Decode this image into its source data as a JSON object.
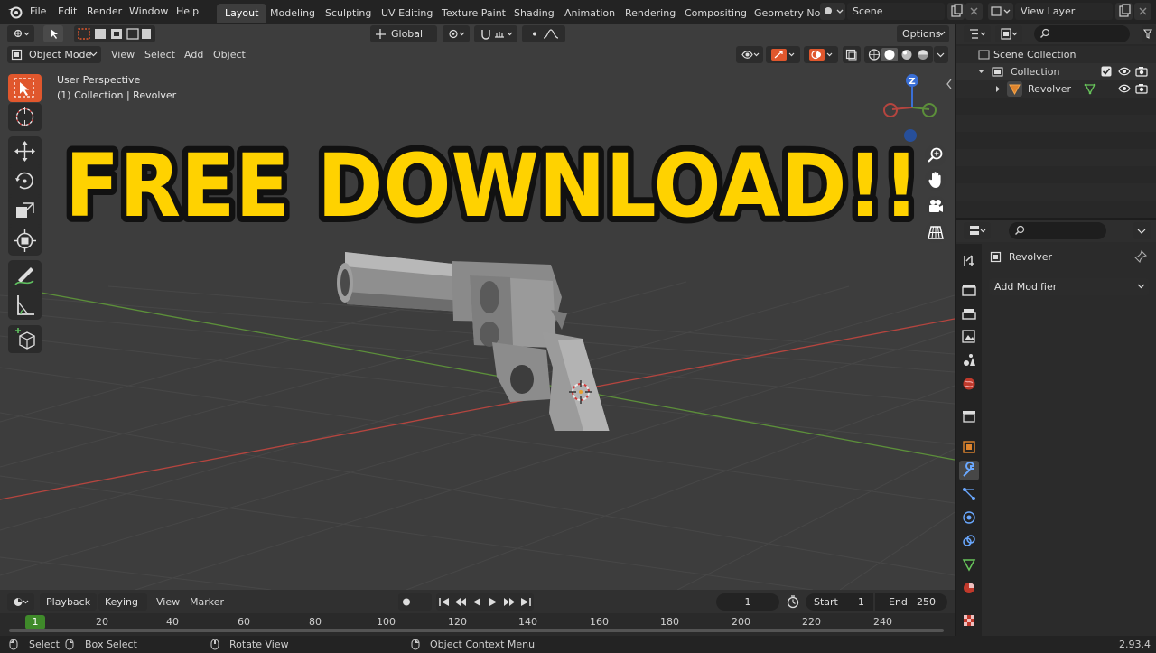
{
  "menu": {
    "items": [
      "File",
      "Edit",
      "Render",
      "Window",
      "Help"
    ]
  },
  "workspaces": {
    "tabs": [
      "Layout",
      "Modeling",
      "Sculpting",
      "UV Editing",
      "Texture Paint",
      "Shading",
      "Animation",
      "Rendering",
      "Compositing",
      "Geometry No"
    ],
    "active": "Layout"
  },
  "scene": {
    "name": "Scene"
  },
  "view_layer": {
    "name": "View Layer"
  },
  "header": {
    "transform_orientation": "Global",
    "options_label": "Options",
    "mode": "Object Mode",
    "menus": [
      "View",
      "Select",
      "Add",
      "Object"
    ]
  },
  "viewport": {
    "perspective_label": "User Perspective",
    "collection_label": "(1) Collection | Revolver",
    "banner_text": "FREE DOWNLOAD!!",
    "gizmo_axis_label": "Z"
  },
  "timeline": {
    "menus": [
      "Playback",
      "Keying",
      "View",
      "Marker"
    ],
    "current_frame": "1",
    "start_label": "Start",
    "start_value": "1",
    "end_label": "End",
    "end_value": "250",
    "ruler_current": "1",
    "ruler_ticks": [
      "20",
      "40",
      "60",
      "80",
      "100",
      "120",
      "140",
      "160",
      "180",
      "200",
      "220",
      "240"
    ]
  },
  "outliner": {
    "scene_collection": "Scene Collection",
    "collection": "Collection",
    "object": "Revolver"
  },
  "properties": {
    "object_name": "Revolver",
    "add_modifier": "Add Modifier"
  },
  "statusbar": {
    "select": "Select",
    "box_select": "Box Select",
    "rotate_view": "Rotate View",
    "context_menu": "Object Context Menu",
    "version": "2.93.4"
  },
  "colors": {
    "accent": "#e0572d",
    "banner_fill": "#ffd200",
    "viewport_bg": "#3d3d3d",
    "axis_x": "#b5453f",
    "axis_y": "#5c8f3a",
    "axis_z": "#3a6fd6"
  }
}
